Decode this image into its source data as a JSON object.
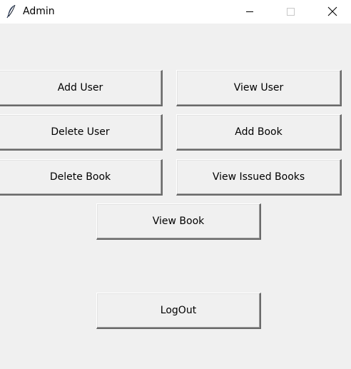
{
  "window": {
    "title": "Admin",
    "app_icon": "feather-icon",
    "controls": {
      "minimize_icon": "minimize-icon",
      "maximize_icon": "maximize-icon",
      "close_icon": "close-icon"
    }
  },
  "buttons": {
    "add_user": "Add User",
    "view_user": "View User",
    "delete_user": "Delete User",
    "add_book": "Add Book",
    "delete_book": "Delete Book",
    "view_issued_books": "View Issued Books",
    "view_book": "View Book",
    "logout": "LogOut"
  }
}
